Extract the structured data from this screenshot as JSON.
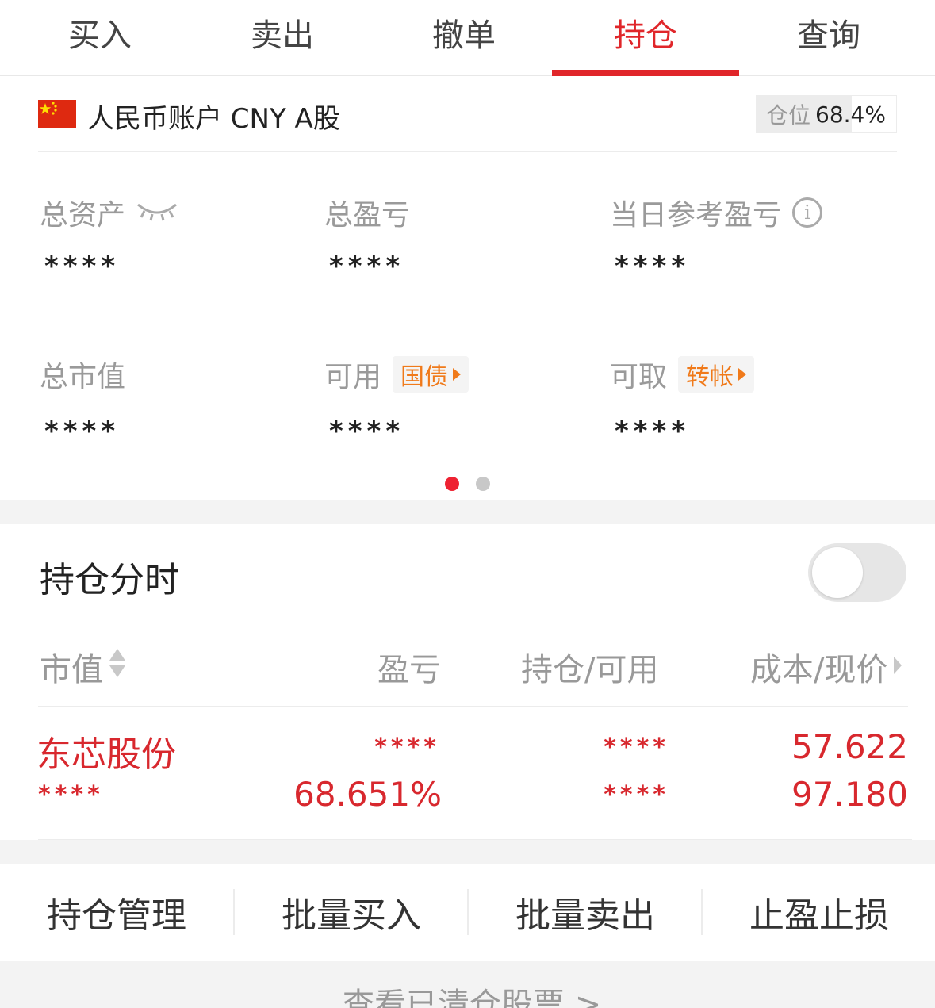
{
  "tabs": [
    {
      "label": "买入",
      "active": false
    },
    {
      "label": "卖出",
      "active": false
    },
    {
      "label": "撤单",
      "active": false
    },
    {
      "label": "持仓",
      "active": true
    },
    {
      "label": "查询",
      "active": false
    }
  ],
  "account": {
    "name": "人民币账户 CNY A股",
    "position_label": "仓位",
    "position_value": "68.4%",
    "position_fraction": 0.684
  },
  "assets": {
    "total_assets": {
      "label": "总资产",
      "value": "****"
    },
    "total_pnl": {
      "label": "总盈亏",
      "value": "****"
    },
    "daily_ref_pnl": {
      "label": "当日参考盈亏",
      "value": "****"
    },
    "market_value": {
      "label": "总市值",
      "value": "****"
    },
    "available": {
      "label": "可用",
      "tag": "国债",
      "value": "****"
    },
    "withdrawable": {
      "label": "可取",
      "tag": "转帐",
      "value": "****"
    }
  },
  "pager": {
    "count": 2,
    "active": 0
  },
  "intraday": {
    "title": "持仓分时",
    "enabled": false
  },
  "table": {
    "headers": {
      "market_value": "市值",
      "pnl": "盈亏",
      "holding": "持仓/可用",
      "cost_price": "成本/现价"
    },
    "rows": [
      {
        "name": "东芯股份",
        "market_value": "****",
        "pnl_amount": "****",
        "pnl_percent": "68.651%",
        "holding": "****",
        "available": "****",
        "cost": "57.622",
        "price": "97.180"
      }
    ]
  },
  "actions": [
    "持仓管理",
    "批量买入",
    "批量卖出",
    "止盈止损"
  ],
  "footer": {
    "link": "查看已清仓股票 >"
  },
  "colors": {
    "accent": "#e0262a",
    "tag": "#f07a1a",
    "muted": "#999999"
  }
}
